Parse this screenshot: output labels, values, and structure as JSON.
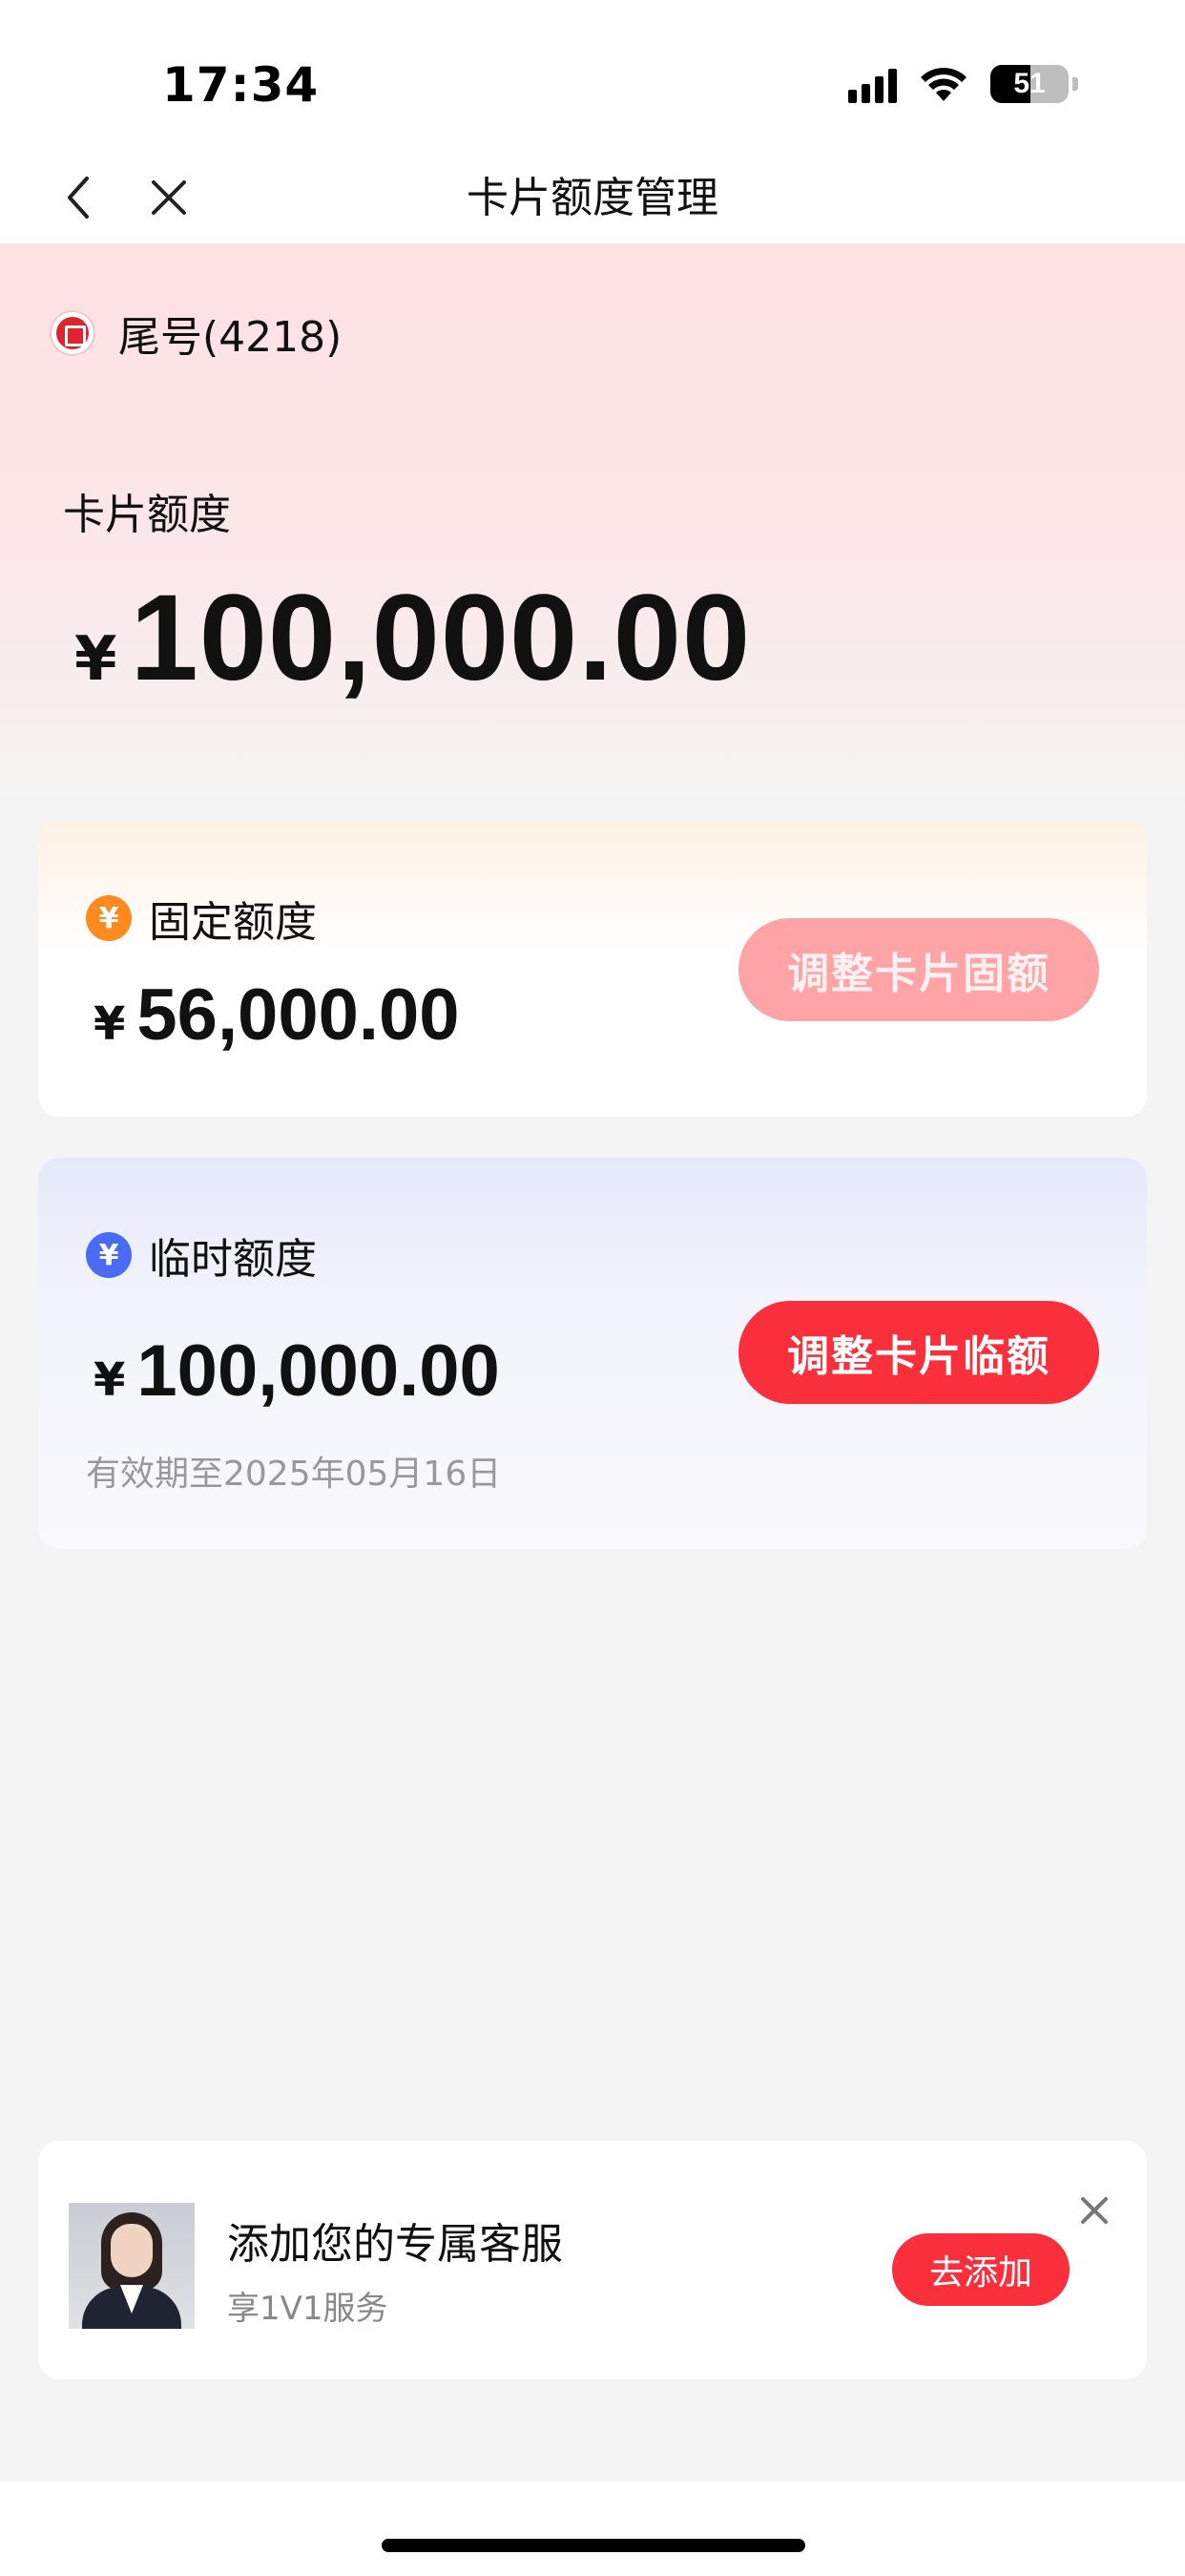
{
  "status_bar": {
    "time": "17:34",
    "battery_level": "51",
    "signal_icon": "signal-bars-icon",
    "wifi_icon": "wifi-icon"
  },
  "nav": {
    "title": "卡片额度管理",
    "back_icon": "chevron-left-icon",
    "close_icon": "close-icon"
  },
  "hero": {
    "card_tail": "尾号(4218)",
    "limit_label": "卡片额度",
    "currency": "¥",
    "limit_amount": "100,000.00"
  },
  "fixed_limit": {
    "title": "固定额度",
    "currency": "¥",
    "amount": "56,000.00",
    "button_label": "调整卡片固额",
    "button_color": "#fea3a6"
  },
  "temp_limit": {
    "title": "临时额度",
    "currency": "¥",
    "amount": "100,000.00",
    "expiry": "有效期至2025年05月16日",
    "button_label": "调整卡片临额",
    "button_color": "#fa2f3c"
  },
  "service": {
    "title": "添加您的专属客服",
    "subtitle": "享1V1服务",
    "button_label": "去添加"
  },
  "colors": {
    "accent_red": "#fa2f3c",
    "coin_orange": "#ff8a1f",
    "coin_blue": "#4a6cf4"
  }
}
